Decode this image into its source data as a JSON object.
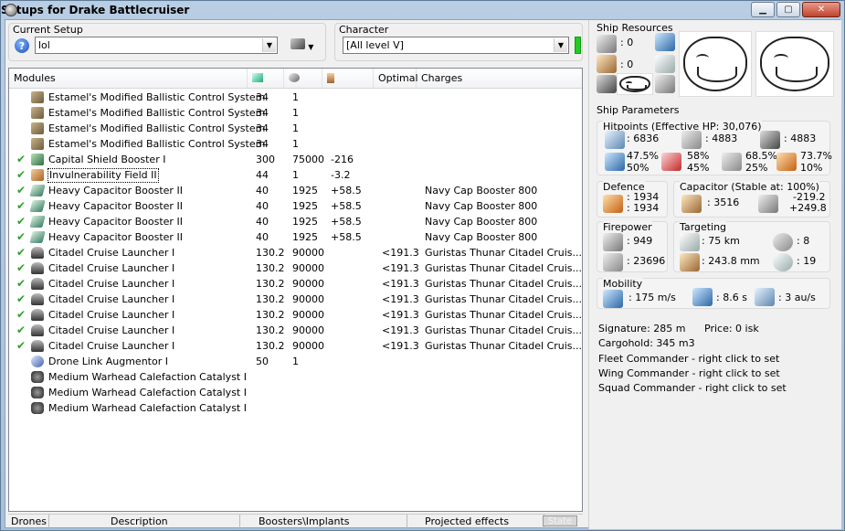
{
  "window": {
    "title": "Setups for Drake Battlecruiser",
    "buttons": {
      "min": "▁",
      "max": "▢",
      "close": "✕"
    }
  },
  "current_setup": {
    "label": "Current Setup",
    "value": "lol"
  },
  "character": {
    "label": "Character",
    "value": "[All level V]"
  },
  "list": {
    "headers": {
      "modules": "Modules",
      "optimal": "Optimal",
      "charges": "Charges"
    },
    "rows": [
      {
        "checked": false,
        "icon": "bcs",
        "name": "Estamel's Modified Ballistic Control System",
        "c1": "34",
        "c2": "1",
        "c3": "",
        "c4": "",
        "c5": ""
      },
      {
        "checked": false,
        "icon": "bcs",
        "name": "Estamel's Modified Ballistic Control System",
        "c1": "34",
        "c2": "1",
        "c3": "",
        "c4": "",
        "c5": ""
      },
      {
        "checked": false,
        "icon": "bcs",
        "name": "Estamel's Modified Ballistic Control System",
        "c1": "34",
        "c2": "1",
        "c3": "",
        "c4": "",
        "c5": ""
      },
      {
        "checked": false,
        "icon": "bcs",
        "name": "Estamel's Modified Ballistic Control System",
        "c1": "34",
        "c2": "1",
        "c3": "",
        "c4": "",
        "c5": ""
      },
      {
        "checked": true,
        "icon": "shb",
        "name": "Capital Shield Booster I",
        "c1": "300",
        "c2": "75000",
        "c3": "-216",
        "c4": "",
        "c5": ""
      },
      {
        "checked": true,
        "icon": "inv",
        "name": "Invulnerability Field II",
        "c1": "44",
        "c2": "1",
        "c3": "-3.2",
        "c4": "",
        "c5": "",
        "selected": true
      },
      {
        "checked": true,
        "icon": "cap",
        "name": "Heavy Capacitor Booster II",
        "c1": "40",
        "c2": "1925",
        "c3": "+58.5",
        "c4": "",
        "c5": "Navy Cap Booster 800"
      },
      {
        "checked": true,
        "icon": "cap",
        "name": "Heavy Capacitor Booster II",
        "c1": "40",
        "c2": "1925",
        "c3": "+58.5",
        "c4": "",
        "c5": "Navy Cap Booster 800"
      },
      {
        "checked": true,
        "icon": "cap",
        "name": "Heavy Capacitor Booster II",
        "c1": "40",
        "c2": "1925",
        "c3": "+58.5",
        "c4": "",
        "c5": "Navy Cap Booster 800"
      },
      {
        "checked": true,
        "icon": "cap",
        "name": "Heavy Capacitor Booster II",
        "c1": "40",
        "c2": "1925",
        "c3": "+58.5",
        "c4": "",
        "c5": "Navy Cap Booster 800"
      },
      {
        "checked": true,
        "icon": "lau",
        "name": "Citadel Cruise Launcher I",
        "c1": "130.2",
        "c2": "90000",
        "c3": "",
        "c4": "<191.3",
        "c5": "Guristas Thunar Citadel Cruis..."
      },
      {
        "checked": true,
        "icon": "lau",
        "name": "Citadel Cruise Launcher I",
        "c1": "130.2",
        "c2": "90000",
        "c3": "",
        "c4": "<191.3",
        "c5": "Guristas Thunar Citadel Cruis..."
      },
      {
        "checked": true,
        "icon": "lau",
        "name": "Citadel Cruise Launcher I",
        "c1": "130.2",
        "c2": "90000",
        "c3": "",
        "c4": "<191.3",
        "c5": "Guristas Thunar Citadel Cruis..."
      },
      {
        "checked": true,
        "icon": "lau",
        "name": "Citadel Cruise Launcher I",
        "c1": "130.2",
        "c2": "90000",
        "c3": "",
        "c4": "<191.3",
        "c5": "Guristas Thunar Citadel Cruis..."
      },
      {
        "checked": true,
        "icon": "lau",
        "name": "Citadel Cruise Launcher I",
        "c1": "130.2",
        "c2": "90000",
        "c3": "",
        "c4": "<191.3",
        "c5": "Guristas Thunar Citadel Cruis..."
      },
      {
        "checked": true,
        "icon": "lau",
        "name": "Citadel Cruise Launcher I",
        "c1": "130.2",
        "c2": "90000",
        "c3": "",
        "c4": "<191.3",
        "c5": "Guristas Thunar Citadel Cruis..."
      },
      {
        "checked": true,
        "icon": "lau",
        "name": "Citadel Cruise Launcher I",
        "c1": "130.2",
        "c2": "90000",
        "c3": "",
        "c4": "<191.3",
        "c5": "Guristas Thunar Citadel Cruis..."
      },
      {
        "checked": false,
        "icon": "dro",
        "name": "Drone Link Augmentor I",
        "c1": "50",
        "c2": "1",
        "c3": "",
        "c4": "",
        "c5": ""
      },
      {
        "checked": false,
        "icon": "cat",
        "name": "Medium Warhead Calefaction Catalyst I",
        "c1": "",
        "c2": "",
        "c3": "",
        "c4": "",
        "c5": ""
      },
      {
        "checked": false,
        "icon": "cat",
        "name": "Medium Warhead Calefaction Catalyst I",
        "c1": "",
        "c2": "",
        "c3": "",
        "c4": "",
        "c5": ""
      },
      {
        "checked": false,
        "icon": "cat",
        "name": "Medium Warhead Calefaction Catalyst I",
        "c1": "",
        "c2": "",
        "c3": "",
        "c4": "",
        "c5": ""
      }
    ]
  },
  "bottom_tabs": {
    "drones": "Drones",
    "description": "Description",
    "boosters": "Boosters\\Implants",
    "projected": "Projected effects",
    "state": "State"
  },
  "resources": {
    "label": "Ship Resources",
    "r1": ": 0",
    "r2": ": 0"
  },
  "params": {
    "label": "Ship Parameters",
    "hitpoints": {
      "label": "Hitpoints (Effective HP: 30,076)",
      "shield": ": 6836",
      "armor": ": 4883",
      "structure": ": 4883",
      "em": "47.5%",
      "em2": "50%",
      "th": "58%",
      "th2": "45%",
      "kin": "68.5%",
      "kin2": "25%",
      "exp": "73.7%",
      "exp2": "10%"
    },
    "defence": {
      "label": "Defence",
      "v1": ": 1934",
      "v2": ": 1934"
    },
    "capacitor": {
      "label": "Capacitor (Stable at: 100%)",
      "cap": ": 3516",
      "d1": "-219.2",
      "d2": "+249.8"
    },
    "firepower": {
      "label": "Firepower",
      "v1": ": 949",
      "v2": ": 23696"
    },
    "targeting": {
      "label": "Targeting",
      "range": ": 75 km",
      "res": ": 243.8 mm",
      "max": ": 8",
      "sig": ": 19"
    },
    "mobility": {
      "label": "Mobility",
      "speed": ": 175 m/s",
      "align": ": 8.6 s",
      "warp": ": 3 au/s"
    },
    "signature": "Signature: 285 m",
    "price": "Price: 0 isk",
    "cargohold": "Cargohold: 345 m3",
    "fleet": "Fleet Commander - right click to set",
    "wing": "Wing Commander - right click to set",
    "squad": "Squad Commander - right click to set"
  }
}
